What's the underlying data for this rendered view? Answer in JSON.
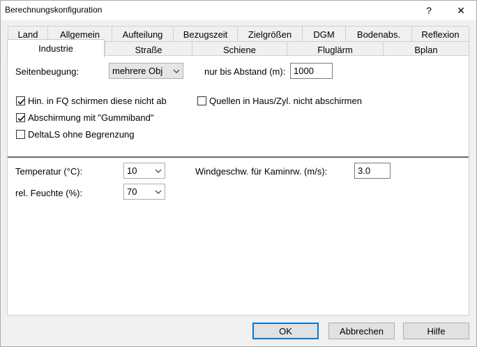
{
  "window": {
    "title": "Berechnungskonfiguration",
    "help_glyph": "?",
    "close_glyph": "✕"
  },
  "tabs_row1": [
    "Land",
    "Allgemein",
    "Aufteilung",
    "Bezugszeit",
    "Zielgrößen",
    "DGM",
    "Bodenabs.",
    "Reflexion"
  ],
  "tabs_row2": [
    "Industrie",
    "Straße",
    "Schiene",
    "Fluglärm",
    "Bplan"
  ],
  "active_tab": "Industrie",
  "panel": {
    "seitenbeugung_label": "Seitenbeugung:",
    "seitenbeugung_value": "mehrere Obj",
    "abstand_label": "nur bis Abstand (m):",
    "abstand_value": "1000",
    "checkboxes": [
      {
        "label": "Hin. in FQ schirmen diese nicht ab",
        "checked": true
      },
      {
        "label": "Abschirmung mit \"Gummiband\"",
        "checked": true
      },
      {
        "label": "DeltaLS ohne Begrenzung",
        "checked": false
      },
      {
        "label": "Quellen in Haus/Zyl. nicht abschirmen",
        "checked": false
      }
    ],
    "temperatur_label": "Temperatur (°C):",
    "temperatur_value": "10",
    "feuchte_label": "rel. Feuchte (%):",
    "feuchte_value": "70",
    "wind_label": "Windgeschw. für Kaminrw. (m/s):",
    "wind_value": "3.0"
  },
  "buttons": {
    "ok": "OK",
    "cancel": "Abbrechen",
    "help": "Hilfe"
  },
  "colors": {
    "default_button_border": "#0078d7",
    "window_bg": "#f0f0f0",
    "panel_bg": "#ffffff"
  }
}
